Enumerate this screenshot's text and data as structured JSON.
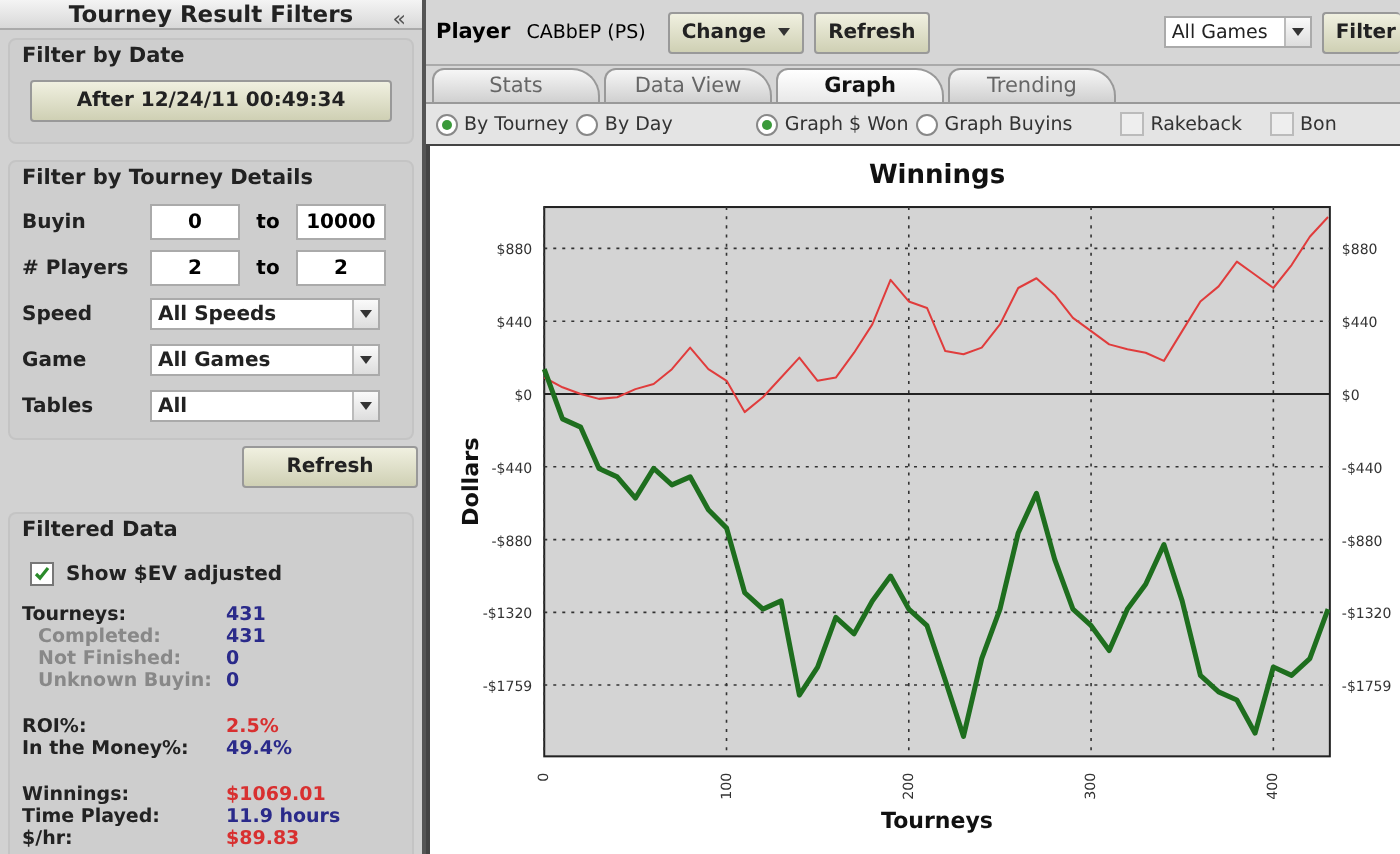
{
  "sidebar": {
    "title": "Tourney Result Filters",
    "collapse_glyph": "«",
    "date_filter": {
      "title": "Filter by Date",
      "button": "After 12/24/11 00:49:34"
    },
    "details_filter": {
      "title": "Filter by Tourney Details",
      "ranges": [
        {
          "label": "Buyin",
          "from": "0",
          "sep": "to",
          "to": "10000"
        },
        {
          "label": "# Players",
          "from": "2",
          "sep": "to",
          "to": "2"
        }
      ],
      "selects": [
        {
          "label": "Speed",
          "value": "All Speeds"
        },
        {
          "label": "Game",
          "value": "All Games"
        },
        {
          "label": "Tables",
          "value": "All"
        }
      ]
    },
    "refresh_button": "Refresh",
    "filtered_data": {
      "title": "Filtered Data",
      "ev_checkbox": {
        "label": "Show $EV adjusted",
        "checked": true
      },
      "groups": [
        [
          {
            "label": "Tourneys:",
            "value": "431",
            "sub": false,
            "color": "#2a2a8a"
          },
          {
            "label": "Completed:",
            "value": "431",
            "sub": true,
            "color": "#2a2a8a"
          },
          {
            "label": "Not Finished:",
            "value": "0",
            "sub": true,
            "color": "#2a2a8a"
          },
          {
            "label": "Unknown Buyin:",
            "value": "0",
            "sub": true,
            "color": "#2a2a8a"
          }
        ],
        [
          {
            "label": "ROI%:",
            "value": "2.5%",
            "sub": false,
            "color": "#d83030"
          },
          {
            "label": "In the Money%:",
            "value": "49.4%",
            "sub": false,
            "color": "#2a2a8a"
          }
        ],
        [
          {
            "label": "Winnings:",
            "value": "$1069.01",
            "sub": false,
            "color": "#d83030"
          },
          {
            "label": "Time Played:",
            "value": "11.9 hours",
            "sub": false,
            "color": "#2a2a8a"
          },
          {
            "label": "$/hr:",
            "value": "$89.83",
            "sub": false,
            "color": "#d83030"
          }
        ]
      ]
    }
  },
  "toolbar": {
    "player_label": "Player",
    "player": "CABbEP (PS)",
    "change_button": "Change",
    "refresh_button": "Refresh",
    "game_select": "All Games",
    "filter_button": "Filter"
  },
  "tabs": [
    {
      "label": "Stats",
      "selected": false
    },
    {
      "label": "Data View",
      "selected": false
    },
    {
      "label": "Graph",
      "selected": true
    },
    {
      "label": "Trending",
      "selected": false
    }
  ],
  "options": {
    "mode_radios": [
      {
        "label": "By Tourney",
        "selected": true
      },
      {
        "label": "By Day",
        "selected": false
      }
    ],
    "graph_radios": [
      {
        "label": "Graph $ Won",
        "selected": true
      },
      {
        "label": "Graph Buyins",
        "selected": false
      }
    ],
    "checkboxes": [
      {
        "label": "Rakeback",
        "checked": false
      },
      {
        "label": "Bon",
        "checked": false
      }
    ]
  },
  "graph": {
    "right_axis_labels": [
      "$880",
      "$440",
      "$0",
      "-$440",
      "-$880",
      "-$1320",
      "-$1759"
    ],
    "chart_data": {
      "type": "line",
      "title": "Winnings",
      "xlabel": "Tourneys",
      "ylabel": "Dollars",
      "x": [
        0,
        10,
        20,
        30,
        40,
        50,
        60,
        70,
        80,
        90,
        100,
        110,
        120,
        130,
        140,
        150,
        160,
        170,
        180,
        190,
        200,
        210,
        220,
        230,
        240,
        250,
        260,
        270,
        280,
        290,
        300,
        310,
        320,
        330,
        340,
        350,
        360,
        370,
        380,
        390,
        400,
        410,
        420,
        430
      ],
      "series": [
        {
          "color": "#e03c3c",
          "values": [
            100,
            40,
            0,
            -30,
            -20,
            30,
            60,
            150,
            280,
            150,
            80,
            -110,
            -20,
            100,
            220,
            80,
            100,
            250,
            420,
            690,
            560,
            520,
            260,
            240,
            280,
            420,
            640,
            700,
            600,
            460,
            380,
            300,
            270,
            250,
            200,
            380,
            560,
            650,
            800,
            720,
            640,
            780,
            950,
            1070
          ]
        },
        {
          "color": "#1e6e1e",
          "values": [
            150,
            -150,
            -200,
            -450,
            -500,
            -630,
            -450,
            -550,
            -500,
            -700,
            -810,
            -1200,
            -1300,
            -1250,
            -1820,
            -1650,
            -1350,
            -1450,
            -1250,
            -1100,
            -1300,
            -1400,
            -1730,
            -2070,
            -1600,
            -1300,
            -840,
            -600,
            -1000,
            -1300,
            -1400,
            -1550,
            -1300,
            -1150,
            -910,
            -1250,
            -1700,
            -1800,
            -1850,
            -2050,
            -1650,
            -1700,
            -1600,
            -1300
          ]
        }
      ],
      "grid": true,
      "xlim": [
        0,
        431
      ],
      "ylim": [
        -2190,
        1130
      ],
      "xticks": [
        0,
        100,
        200,
        300,
        400
      ],
      "yticks": [
        {
          "value": 880,
          "label": "$880"
        },
        {
          "value": 440,
          "label": "$440"
        },
        {
          "value": 0,
          "label": "$0"
        },
        {
          "value": -440,
          "label": "-$440"
        },
        {
          "value": -880,
          "label": "-$880"
        },
        {
          "value": -1320,
          "label": "-$1320"
        },
        {
          "value": -1759,
          "label": "-$1759"
        }
      ]
    }
  }
}
